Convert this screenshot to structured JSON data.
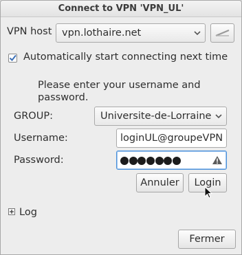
{
  "window": {
    "title": "Connect to VPN 'VPN_UL'"
  },
  "vpn_host": {
    "label": "VPN host",
    "value": "vpn.lothaire.net"
  },
  "auto_connect": {
    "label": "Automatically start connecting next time",
    "checked": true
  },
  "prompt": {
    "line1": "Please enter your username and",
    "line2": "password."
  },
  "group": {
    "label": "GROUP:",
    "value": "Universite-de-Lorraine"
  },
  "username": {
    "label": "Username:",
    "value": "loginUL@groupeVPN"
  },
  "password": {
    "label": "Password:",
    "masked_length": 7
  },
  "buttons": {
    "cancel": "Annuler",
    "login": "Login",
    "close": "Fermer"
  },
  "log": {
    "label": "Log"
  },
  "colors": {
    "focus": "#4a90d9",
    "warning_icon": "#5c5c5c"
  }
}
